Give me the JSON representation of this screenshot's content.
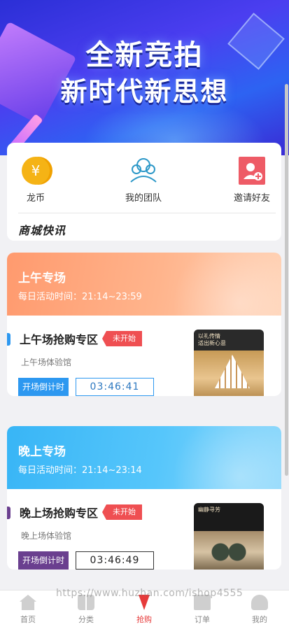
{
  "banner": {
    "line1": "全新竞拍",
    "line2": "新时代新思想"
  },
  "menu": [
    {
      "label": "龙币",
      "icon": "coin-icon",
      "glyph": "¥"
    },
    {
      "label": "我的团队",
      "icon": "team-icon"
    },
    {
      "label": "邀请好友",
      "icon": "invite-friend-icon"
    }
  ],
  "news": {
    "title": "商城快讯"
  },
  "sessions": [
    {
      "title": "上午专场",
      "time": "每日活动时间：21:14~23:59",
      "zone": "上午场抢购专区",
      "status": "未开始",
      "venue": "上午场体验馆",
      "countdown_label": "开场倒计时",
      "countdown": "03:46:41",
      "thumb_text": "以礼传情\n适出新心意",
      "accent_color": "#2d98f0"
    },
    {
      "title": "晚上专场",
      "time": "每日活动时间：21:14~23:14",
      "zone": "晚上场抢购专区",
      "status": "未开始",
      "venue": "晚上场体验馆",
      "countdown_label": "开场倒计时",
      "countdown": "03:46:49",
      "thumb_text": "幽静寻芳",
      "accent_color": "#6a3f8f"
    }
  ],
  "tabbar": [
    {
      "label": "首页",
      "icon": "home-icon"
    },
    {
      "label": "分类",
      "icon": "category-icon"
    },
    {
      "label": "抢购",
      "icon": "flash-sale-icon",
      "active": true
    },
    {
      "label": "订单",
      "icon": "order-icon"
    },
    {
      "label": "我的",
      "icon": "profile-icon"
    }
  ],
  "watermark": "https://www.huzhan.com/ishop4555",
  "colors": {
    "active_tab": "#e63a3a",
    "badge": "#ef4f52",
    "am_header": "#ff9a6e",
    "pm_header": "#38b5f6"
  }
}
